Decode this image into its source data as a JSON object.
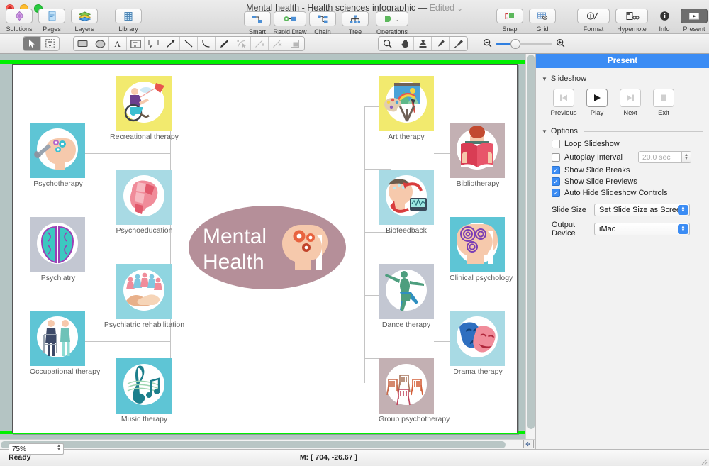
{
  "window": {
    "title": "Mental health - Health sciences infographic",
    "separator": "—",
    "edited": "Edited",
    "chevron": "⌄"
  },
  "toolbar": {
    "left_group": [
      {
        "label": "Solutions",
        "icon": "solutions-icon"
      },
      {
        "label": "Pages",
        "icon": "pages-icon"
      },
      {
        "label": "Layers",
        "icon": "layers-icon"
      }
    ],
    "library_group": [
      {
        "label": "Library",
        "icon": "library-icon"
      }
    ],
    "draw_group": [
      {
        "label": "Smart",
        "icon": "smart-connector-icon"
      },
      {
        "label": "Rapid Draw",
        "icon": "rapid-draw-icon"
      },
      {
        "label": "Chain",
        "icon": "chain-icon"
      },
      {
        "label": "Tree",
        "icon": "tree-icon"
      },
      {
        "label": "Operations",
        "icon": "operations-icon"
      }
    ],
    "view_group": [
      {
        "label": "Snap",
        "icon": "snap-icon"
      },
      {
        "label": "Grid",
        "icon": "grid-icon"
      }
    ],
    "right_group": [
      {
        "label": "Format",
        "icon": "format-icon"
      },
      {
        "label": "Hypernote",
        "icon": "hypernote-icon"
      },
      {
        "label": "Info",
        "icon": "info-icon"
      },
      {
        "label": "Present",
        "icon": "present-icon"
      }
    ]
  },
  "palette": {
    "select_tools": [
      {
        "name": "pointer-tool",
        "selected": true
      },
      {
        "name": "text-select-tool",
        "selected": false
      }
    ],
    "shape_tools": [
      {
        "name": "rectangle-tool",
        "enabled": true
      },
      {
        "name": "ellipse-tool",
        "enabled": true
      },
      {
        "name": "text-tool",
        "enabled": true
      },
      {
        "name": "text-box-tool",
        "enabled": true
      },
      {
        "name": "callout-tool",
        "enabled": true
      },
      {
        "name": "arrow-tool",
        "enabled": true
      },
      {
        "name": "line-tool",
        "enabled": true
      },
      {
        "name": "arc-tool",
        "enabled": true
      },
      {
        "name": "pen-tool",
        "enabled": true
      },
      {
        "name": "edit-point-tool",
        "enabled": false
      },
      {
        "name": "add-point-tool",
        "enabled": false
      },
      {
        "name": "delete-point-tool",
        "enabled": false
      },
      {
        "name": "shape-combine-tool",
        "enabled": false
      }
    ],
    "view_tools": [
      {
        "name": "magnifier-tool"
      },
      {
        "name": "hand-tool"
      },
      {
        "name": "stamp-tool"
      },
      {
        "name": "eyedropper-tool"
      },
      {
        "name": "paintbrush-tool"
      }
    ],
    "zoom": {
      "out_icon": "zoom-out-icon",
      "in_icon": "zoom-in-icon",
      "percent": 25
    }
  },
  "diagram": {
    "center": {
      "line1": "Mental",
      "line2": "Health",
      "color": "#b58f99"
    },
    "left_outer": [
      {
        "label": "Psychotherapy",
        "tile": "#5ec5d5"
      },
      {
        "label": "Psychiatry",
        "tile": "#c3c7d2"
      },
      {
        "label": "Occupational therapy",
        "tile": "#5ec5d5"
      }
    ],
    "left_inner": [
      {
        "label": "Recreational therapy",
        "tile": "#f2ea6e"
      },
      {
        "label": "Psychoeducation",
        "tile": "#a8dae4"
      },
      {
        "label": "Psychiatric rehabilitation",
        "tile": "#8fd5e0"
      },
      {
        "label": "Music therapy",
        "tile": "#5ec5d5"
      }
    ],
    "right_inner": [
      {
        "label": "Art therapy",
        "tile": "#f2ea6e"
      },
      {
        "label": "Biofeedback",
        "tile": "#a8dae4"
      },
      {
        "label": "Dance therapy",
        "tile": "#c3c7d2"
      },
      {
        "label": "Group psychotherapy",
        "tile": "#c3b0b3"
      }
    ],
    "right_outer": [
      {
        "label": "Bibliotherapy",
        "tile": "#c3b0b3"
      },
      {
        "label": "Clinical psychology",
        "tile": "#5ec5d5"
      },
      {
        "label": "Drama therapy",
        "tile": "#a8dae4"
      }
    ],
    "selection_color": "#00f000"
  },
  "panel": {
    "title": "Present",
    "slideshow": {
      "header": "Slideshow",
      "buttons": [
        {
          "label": "Previous",
          "icon": "skip-back-icon",
          "enabled": false
        },
        {
          "label": "Play",
          "icon": "play-icon",
          "enabled": true
        },
        {
          "label": "Next",
          "icon": "skip-forward-icon",
          "enabled": false
        },
        {
          "label": "Exit",
          "icon": "stop-icon",
          "enabled": false
        }
      ]
    },
    "options": {
      "header": "Options",
      "checkboxes": [
        {
          "label": "Loop Slideshow",
          "checked": false
        },
        {
          "label": "Autoplay Interval",
          "checked": false
        },
        {
          "label": "Show Slide Breaks",
          "checked": true
        },
        {
          "label": "Show Slide Previews",
          "checked": true
        },
        {
          "label": "Auto Hide Slideshow Controls",
          "checked": true
        }
      ],
      "autoplay_value": "20.0 sec",
      "fields": [
        {
          "label": "Slide Size",
          "value": "Set Slide Size as Screen"
        },
        {
          "label": "Output Device",
          "value": "iMac"
        }
      ]
    }
  },
  "status": {
    "zoom": "75%",
    "ready": "Ready",
    "mouse": "M: [ 704, -26.67 ]"
  }
}
